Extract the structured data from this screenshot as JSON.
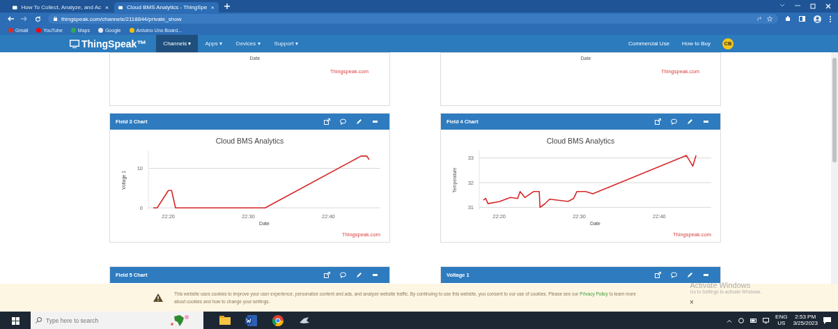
{
  "browser": {
    "tabs": [
      {
        "title": "How To Collect, Analyze, and Ac",
        "selected": false
      },
      {
        "title": "Cloud BMS Analytics - ThingSpe",
        "selected": true
      }
    ],
    "url": "thingspeak.com/channels/2118844/private_show",
    "bookmarks": [
      {
        "label": "Gmail",
        "color": "#d93025"
      },
      {
        "label": "YouTube",
        "color": "#ff0000"
      },
      {
        "label": "Maps",
        "color": "#34a853"
      },
      {
        "label": "Google",
        "color": "#e8eaed"
      },
      {
        "label": "Arduino Uno Board...",
        "color": "#fbbc04"
      }
    ]
  },
  "navbar": {
    "logo": "ThingSpeak™",
    "menus": [
      {
        "label": "Channels ▾",
        "selected": true
      },
      {
        "label": "Apps ▾",
        "selected": false
      },
      {
        "label": "Devices ▾",
        "selected": false
      },
      {
        "label": "Support ▾",
        "selected": false
      }
    ],
    "links": [
      "Commercial Use",
      "How to Buy"
    ],
    "avatar": "CB"
  },
  "cards": [
    {
      "kind": "tail",
      "xlabel": "Date",
      "credit": "Thingspeak.com"
    },
    {
      "kind": "tail",
      "xlabel": "Date",
      "credit": "Thingspeak.com"
    },
    {
      "kind": "chart",
      "title": "Field 3 Chart",
      "credit": "Thingspeak.com",
      "chart_data": {
        "type": "line",
        "title": "Cloud BMS Analytics",
        "xlabel": "Date",
        "ylabel": "Voltage 1",
        "xlim": [
          22.2917,
          22.775
        ],
        "ylim": [
          -0.5,
          14.5
        ],
        "grid": true,
        "xticks": [
          {
            "value": 22.3333,
            "label": "22:20"
          },
          {
            "value": 22.5,
            "label": "22:30"
          },
          {
            "value": 22.6667,
            "label": "22:40"
          }
        ],
        "yticks": [
          0,
          10
        ],
        "series": [
          {
            "color": "#d62728",
            "x": [
              22.3017,
              22.31,
              22.3333,
              22.34,
              22.3483,
              22.4167,
              22.5,
              22.535,
              22.735,
              22.7467,
              22.7517
            ],
            "values": [
              0,
              0,
              4.4,
              4.4,
              0,
              0,
              0,
              0,
              13.1,
              13.1,
              12.2
            ]
          }
        ]
      }
    },
    {
      "kind": "chart",
      "title": "Field 4 Chart",
      "credit": "Thingspeak.com",
      "chart_data": {
        "type": "line",
        "title": "Cloud BMS Analytics",
        "xlabel": "Date",
        "ylabel": "Temperature",
        "xlim": [
          22.2917,
          22.775
        ],
        "ylim": [
          30.9,
          33.3
        ],
        "grid": true,
        "xticks": [
          {
            "value": 22.3333,
            "label": "22:20"
          },
          {
            "value": 22.5,
            "label": "22:30"
          },
          {
            "value": 22.6667,
            "label": "22:40"
          }
        ],
        "yticks": [
          31,
          32,
          33
        ],
        "series": [
          {
            "color": "#d62728",
            "x": [
              22.3,
              22.305,
              22.31,
              22.3333,
              22.3567,
              22.3717,
              22.3767,
              22.3867,
              22.405,
              22.4167,
              22.4183,
              22.4283,
              22.4383,
              22.4767,
              22.4883,
              22.495,
              22.5133,
              22.5283,
              22.7233,
              22.7367,
              22.7433
            ],
            "values": [
              31.29,
              31.36,
              31.15,
              31.23,
              31.4,
              31.36,
              31.64,
              31.4,
              31.64,
              31.64,
              31.0,
              31.14,
              31.33,
              31.24,
              31.36,
              31.64,
              31.64,
              31.55,
              33.1,
              32.67,
              33.1
            ]
          }
        ]
      }
    },
    {
      "kind": "head",
      "title": "Field 5 Chart"
    },
    {
      "kind": "head",
      "title": "Voltage 1"
    }
  ],
  "cookie_banner": {
    "before": "This website uses cookies to improve your user experience, personalize content and ads, and analyze website traffic. By continuing to use this website, you consent to our use of cookies. Please see our ",
    "link": "Privacy Policy",
    "after": " to learn more about cookies and how to change your settings.",
    "close": "×"
  },
  "windows_notice": {
    "title": "Activate Windows",
    "text": "Go to Settings to activate Windows."
  },
  "taskbar": {
    "search_placeholder": "Type here to search",
    "language": "ENG",
    "region": "US",
    "time": "2:53 PM",
    "date": "3/25/2023"
  }
}
